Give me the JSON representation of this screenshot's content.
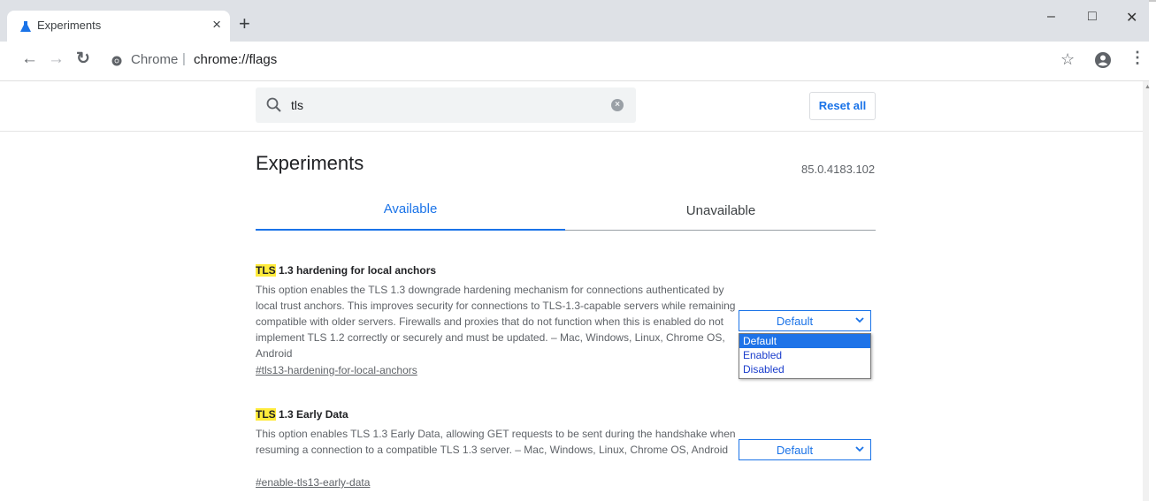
{
  "browser": {
    "tab_title": "Experiments",
    "new_tab": "+",
    "close_tab": "×",
    "window": {
      "minimize": "–",
      "maximize": "□",
      "close": "✕"
    },
    "origin": "Chrome",
    "separator": "|",
    "url": "chrome://flags",
    "colors": {
      "tab_icon": "#1a73e8",
      "accent": "#1a73e8",
      "frame": "#4aa34a"
    }
  },
  "flags_page": {
    "search": {
      "value": "tls",
      "clear_icon": "clear-search-icon"
    },
    "reset_label": "Reset all",
    "heading": "Experiments",
    "version": "85.0.4183.102",
    "tabs": {
      "available": "Available",
      "unavailable": "Unavailable",
      "active": "Available"
    },
    "experiments": [
      {
        "highlight": "TLS",
        "title_rest": " 1.3 hardening for local anchors",
        "description": "This option enables the TLS 1.3 downgrade hardening mechanism for connections authenticated by local trust anchors. This improves security for connections to TLS-1.3-capable servers while remaining compatible with older servers. Firewalls and proxies that do not function when this is enabled do not implement TLS 1.2 correctly or securely and must be updated. – Mac, Windows, Linux, Chrome OS, Android",
        "link": "#tls13-hardening-for-local-anchors",
        "selected": "Default",
        "options": [
          "Default",
          "Enabled",
          "Disabled"
        ],
        "dropdown_open": true,
        "highlighted_option": "Default"
      },
      {
        "highlight": "TLS",
        "title_rest": " 1.3 Early Data",
        "description": "This option enables TLS 1.3 Early Data, allowing GET requests to be sent during the handshake when resuming a connection to a compatible TLS 1.3 server. – Mac, Windows, Linux, Chrome OS, Android",
        "link": "#enable-tls13-early-data",
        "selected": "Default"
      }
    ]
  }
}
